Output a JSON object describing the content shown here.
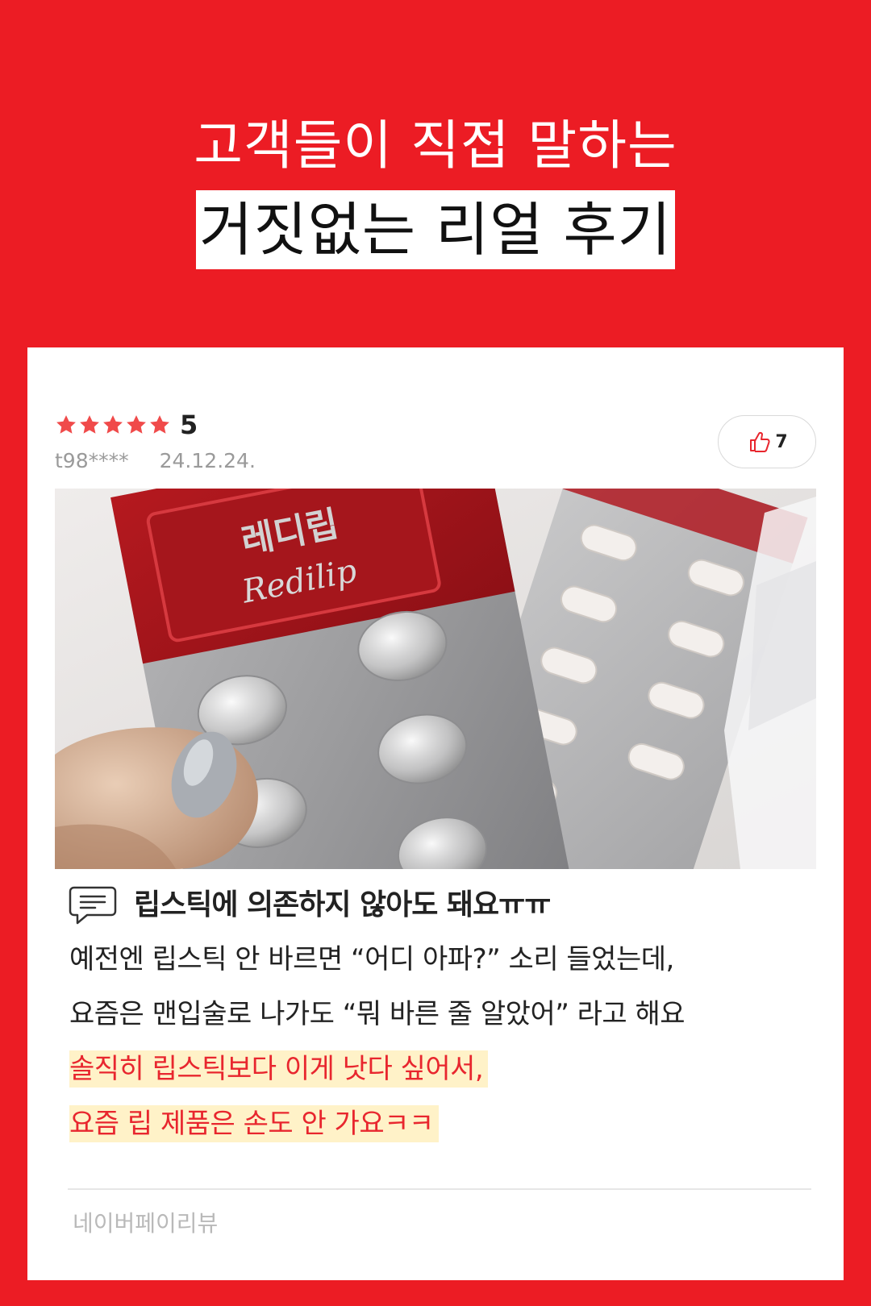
{
  "colors": {
    "background": "#ec1c24",
    "star": "#f04a4a",
    "highlight_text": "#e8262e",
    "highlight_bg": "#fff2c8"
  },
  "headline": {
    "line1": "고객들이 직접 말하는",
    "line2": "거짓없는 리얼 후기"
  },
  "review": {
    "stars": 5,
    "rating": "5",
    "user": "t98****",
    "date": "24.12.24.",
    "likes": "7",
    "photo_label": "레디립",
    "photo_script": "Redilip",
    "photo_label_small": "레디립",
    "title": "립스틱에 의존하지 않아도 돼요ㅠㅠ",
    "body_lines": [
      "예전엔 립스틱 안 바르면 “어디 아파?” 소리 들었는데,",
      "요즘은 맨입술로 나가도 “뭐 바른 줄 알았어” 라고 해요"
    ],
    "highlight_lines": [
      "솔직히 립스틱보다 이게 낫다 싶어서,",
      "요즘 립 제품은 손도 안 가요ㅋㅋ"
    ],
    "source": "네이버페이리뷰"
  }
}
